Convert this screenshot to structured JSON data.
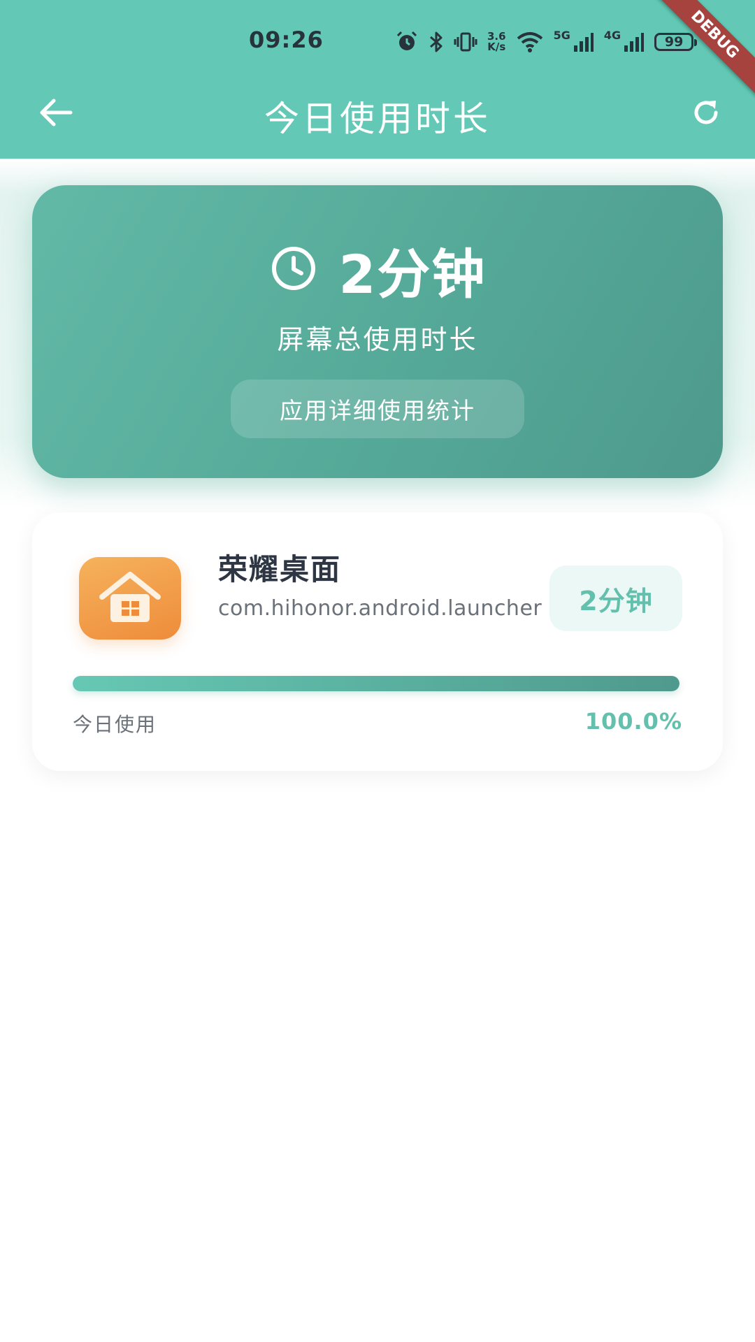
{
  "status_bar": {
    "time": "09:26",
    "net_speed_value": "3.6",
    "net_speed_unit": "K/s",
    "signal_1_label": "5G",
    "signal_2_label": "4G",
    "battery": "99",
    "icons": [
      "alarm-icon",
      "bluetooth-icon",
      "vibrate-icon",
      "wifi-icon",
      "signal-icon",
      "battery-icon"
    ]
  },
  "debug_banner": "DEBUG",
  "header": {
    "title": "今日使用时长",
    "back_icon": "arrow-left-icon",
    "refresh_icon": "refresh-icon",
    "color": "#63c9b6"
  },
  "summary": {
    "total_time": "2分钟",
    "label": "屏幕总使用时长",
    "detail_button": "应用详细使用统计",
    "icon": "clock-icon"
  },
  "apps": [
    {
      "name": "荣耀桌面",
      "package": "com.hihonor.android.launcher",
      "duration": "2分钟",
      "usage_label": "今日使用",
      "usage_percent": "100.0%",
      "usage_fraction": 1.0,
      "icon": "home-icon",
      "icon_color": "#ee8c3b"
    }
  ],
  "colors": {
    "accent": "#63c0ad",
    "card_gradient_start": "#62b9a6",
    "card_gradient_end": "#4e9a8d"
  }
}
